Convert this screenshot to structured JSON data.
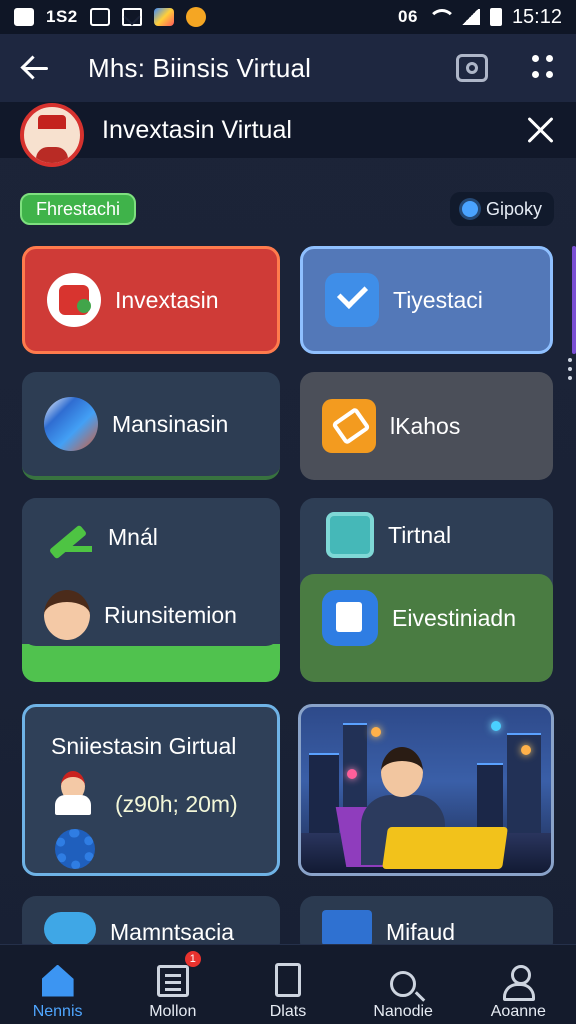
{
  "status_bar": {
    "left_text": "1S2",
    "right_text": "06",
    "time": "15:12",
    "icons": [
      "notification-icon",
      "mail-icon",
      "play-store-icon",
      "app-icon",
      "wifi-icon",
      "signal-icon",
      "battery-icon"
    ]
  },
  "app_bar": {
    "title": "Mhs: Biinsis Virtual",
    "icons": [
      "back-arrow-icon",
      "camera-icon",
      "more-options-icon"
    ]
  },
  "banner": {
    "title": "Invextasin Virtual",
    "icons": [
      "avatar",
      "close-icon"
    ]
  },
  "chips": {
    "left": "Fhrestachi",
    "right": "Gipoky"
  },
  "cards": [
    {
      "label": "Invextasin",
      "icon": "dice-icon"
    },
    {
      "label": "Tiyestaci",
      "icon": "checkmark-icon"
    },
    {
      "label": "Mansinasin",
      "icon": "globe-icon"
    },
    {
      "label": "lKahos",
      "icon": "ticket-icon"
    },
    {
      "label": "Mnál",
      "icon": "pencil-icon"
    },
    {
      "label": "Riunsitemion",
      "icon": "person-icon"
    },
    {
      "label": "Tirtnal",
      "icon": "tablet-icon"
    },
    {
      "label": "Eivestiniadn",
      "icon": "chart-icon"
    }
  ],
  "summary_card": {
    "title": "Sniiestasin Girtual",
    "value": "(ᴢ90h; 20m)"
  },
  "bottom_cards": [
    {
      "label": "Mamntsacia",
      "icon": "cloud-icon"
    },
    {
      "label": "Mifaud",
      "icon": "list-icon"
    }
  ],
  "bottom_nav": {
    "items": [
      {
        "label": "Nennis",
        "icon": "home-icon",
        "active": true
      },
      {
        "label": "Mollon",
        "icon": "document-icon",
        "badge": "1"
      },
      {
        "label": "Dlats",
        "icon": "clipboard-icon"
      },
      {
        "label": "Nanodie",
        "icon": "search-icon"
      },
      {
        "label": "Aoanne",
        "icon": "user-icon"
      }
    ]
  },
  "colors": {
    "background": "#1a2236",
    "accent_blue": "#4fa6ff",
    "accent_green": "#3fb34a",
    "accent_red": "#cf3b37"
  }
}
